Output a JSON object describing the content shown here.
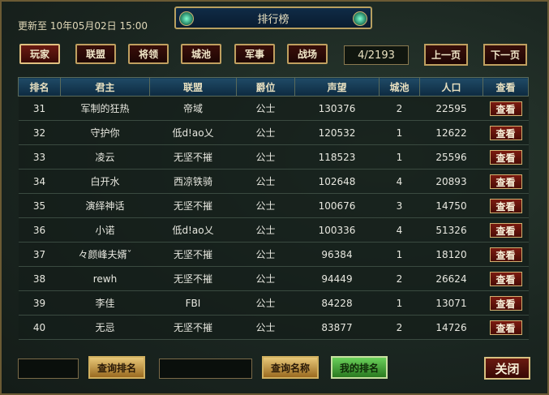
{
  "title": "排行榜",
  "update_text": "更新至 10年05月02日 15:00",
  "tabs": [
    {
      "label": "玩家"
    },
    {
      "label": "联盟"
    },
    {
      "label": "将领"
    },
    {
      "label": "城池"
    },
    {
      "label": "军事"
    },
    {
      "label": "战场"
    }
  ],
  "page_indicator": "4/2193",
  "prev_page": "上一页",
  "next_page": "下一页",
  "columns": [
    "排名",
    "君主",
    "联盟",
    "爵位",
    "声望",
    "城池",
    "人口",
    "查看"
  ],
  "view_label": "查看",
  "rows": [
    {
      "rank": "31",
      "lord": "军制的狂热",
      "alliance": "帝域",
      "title": "公士",
      "prestige": "130376",
      "cities": "2",
      "population": "22595"
    },
    {
      "rank": "32",
      "lord": "守护你",
      "alliance": "低d!ao乂",
      "title": "公士",
      "prestige": "120532",
      "cities": "1",
      "population": "12622"
    },
    {
      "rank": "33",
      "lord": "凌云",
      "alliance": "无坚不摧",
      "title": "公士",
      "prestige": "118523",
      "cities": "1",
      "population": "25596"
    },
    {
      "rank": "34",
      "lord": "白开水",
      "alliance": "西凉铁骑",
      "title": "公士",
      "prestige": "102648",
      "cities": "4",
      "population": "20893"
    },
    {
      "rank": "35",
      "lord": "演绎神话",
      "alliance": "无坚不摧",
      "title": "公士",
      "prestige": "100676",
      "cities": "3",
      "population": "14750"
    },
    {
      "rank": "36",
      "lord": "小诺",
      "alliance": "低d!ao乂",
      "title": "公士",
      "prestige": "100336",
      "cities": "4",
      "population": "51326"
    },
    {
      "rank": "37",
      "lord": "々颜峰夫婿ˇ",
      "alliance": "无坚不摧",
      "title": "公士",
      "prestige": "96384",
      "cities": "1",
      "population": "18120"
    },
    {
      "rank": "38",
      "lord": "rewh",
      "alliance": "无坚不摧",
      "title": "公士",
      "prestige": "94449",
      "cities": "2",
      "population": "26624"
    },
    {
      "rank": "39",
      "lord": "李佳",
      "alliance": "FBI",
      "title": "公士",
      "prestige": "84228",
      "cities": "1",
      "population": "13071"
    },
    {
      "rank": "40",
      "lord": "无忌",
      "alliance": "无坚不摧",
      "title": "公士",
      "prestige": "83877",
      "cities": "2",
      "population": "14726"
    }
  ],
  "search_rank_label": "查询排名",
  "search_name_label": "查询名称",
  "my_rank_label": "我的排名",
  "close_label": "关闭",
  "colors": {
    "tab_bg": "#3a0f0a",
    "header_bg": "#1f4a66",
    "accent_gold": "#c0a060"
  }
}
